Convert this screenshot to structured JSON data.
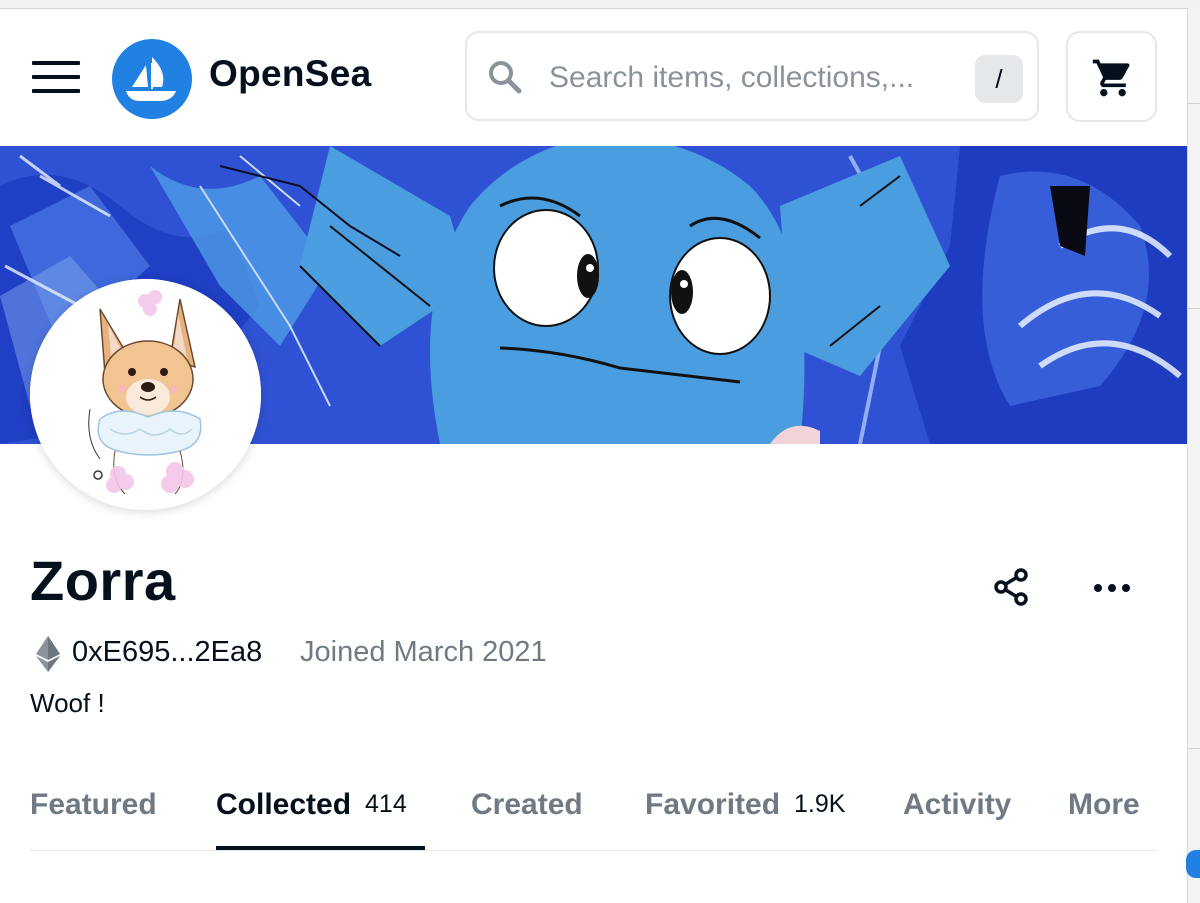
{
  "header": {
    "brand": "OpenSea",
    "search_placeholder": "Search items, collections,...",
    "search_shortcut": "/",
    "icons": [
      "menu-icon",
      "opensea-logo-icon",
      "search-icon",
      "cart-icon"
    ]
  },
  "profile": {
    "name": "Zorra",
    "address": "0xE695...2Ea8",
    "joined": "Joined March 2021",
    "bio": "Woof !",
    "icons": [
      "ethereum-icon",
      "share-icon",
      "more-icon"
    ]
  },
  "tabs": [
    {
      "label": "Featured",
      "count": ""
    },
    {
      "label": "Collected",
      "count": "414",
      "active": true
    },
    {
      "label": "Created",
      "count": ""
    },
    {
      "label": "Favorited",
      "count": "1.9K"
    },
    {
      "label": "Activity",
      "count": ""
    },
    {
      "label": "More",
      "count": ""
    }
  ],
  "colors": {
    "accent": "#2081e2",
    "text_primary": "#04111d",
    "text_secondary": "#707a83",
    "border": "#e5e8eb",
    "banner_blue": "#4a9ee0"
  }
}
